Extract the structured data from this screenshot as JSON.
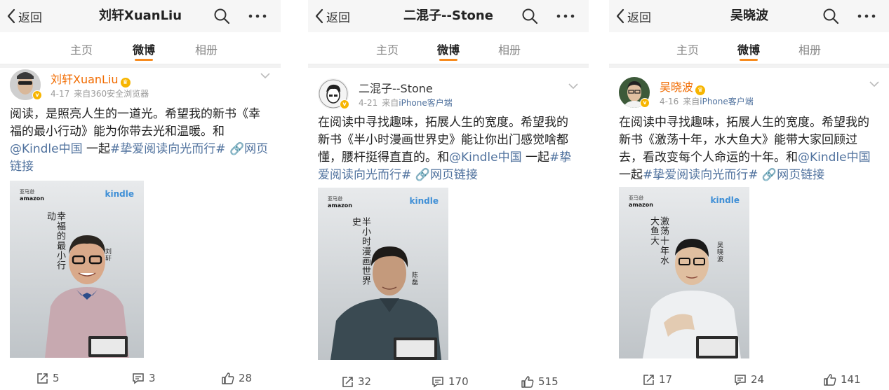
{
  "nav": {
    "back_label": "返回"
  },
  "tabs": [
    "主页",
    "微博",
    "相册"
  ],
  "panels": [
    {
      "title": "刘轩XuanLiu",
      "author": "刘轩XuanLiu",
      "date": "4-17",
      "source": "来自360安全浏览器",
      "text_parts": [
        "阅读，是照亮人生的一道光。希望我的新书《幸福的最小行动》能为你带去光和温暖。和",
        "@Kindle中国",
        " 一起",
        "#挚爱阅读向光而行#",
        " ",
        "🔗网页链接"
      ],
      "poster": {
        "brand_top": "亚马逊",
        "brand_bottom": "amazon",
        "kindle": "kindle",
        "book_title": "幸福的最小行动",
        "author_name": "刘轩"
      },
      "stats": {
        "reposts": "5",
        "comments": "3",
        "likes": "28"
      }
    },
    {
      "title": "二混子--Stone",
      "author": "二混子--Stone",
      "date": "4-21",
      "source": "来自",
      "source_link": "iPhone客户端",
      "text_parts": [
        "在阅读中寻找趣味，拓展人生的宽度。希望我的新书《半小时漫画世界史》能让你出门感觉啥都懂，腰杆挺得直直的。和",
        "@Kindle中国",
        " 一起",
        "#挚爱阅读向光而行#",
        " ",
        "🔗网页链接"
      ],
      "poster": {
        "brand_top": "亚马逊",
        "brand_bottom": "amazon",
        "kindle": "kindle",
        "book_title": "半小时漫画世界史",
        "author_name": "陈磊"
      },
      "stats": {
        "reposts": "32",
        "comments": "170",
        "likes": "515"
      }
    },
    {
      "title": "吴晓波",
      "author": "吴晓波",
      "date": "4-16",
      "source": "来自",
      "source_link": "iPhone客户端",
      "text_parts": [
        "在阅读中寻找趣味，拓展人生的宽度。希望我的新书《激荡十年，水大鱼大》能带大家回顾过去，看改变每个人命运的十年。和",
        "@Kindle中国",
        "一起",
        "#挚爱阅读向光而行#",
        " ",
        "🔗网页链接"
      ],
      "poster": {
        "brand_top": "亚马逊",
        "brand_bottom": "amazon",
        "kindle": "kindle",
        "book_title": "激荡十年水大鱼大",
        "author_name": "吴晓波"
      },
      "stats": {
        "reposts": "17",
        "comments": "24",
        "likes": "141"
      }
    }
  ],
  "colors": {
    "accent": "#f68b1f",
    "link": "#50729e",
    "name_vip": "#f16b00",
    "kindle_blue": "#3f8fd6"
  }
}
